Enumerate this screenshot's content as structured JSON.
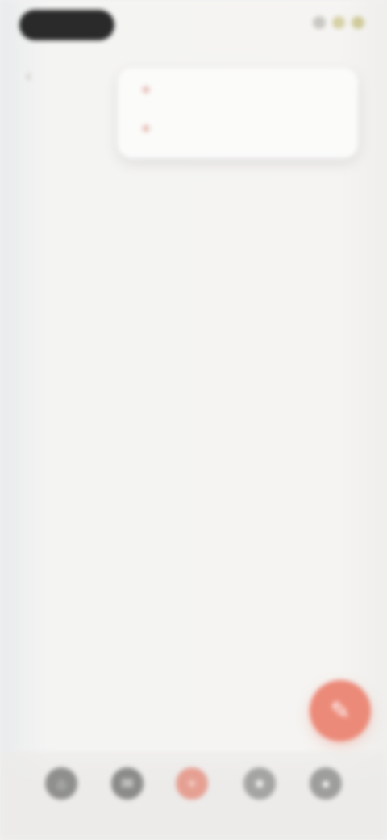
{
  "status_bar": {
    "time": "",
    "icons": [
      "signal-icon",
      "wifi-icon",
      "battery-icon"
    ]
  },
  "header": {
    "back_icon": "back-arrow-icon"
  },
  "popup_menu": {
    "items": [
      {
        "label": "",
        "icon": "dot-icon"
      },
      {
        "label": "",
        "icon": "dot-icon"
      }
    ]
  },
  "article": {
    "heading": "",
    "paragraphs": [
      "",
      "",
      "",
      "",
      "",
      ""
    ]
  },
  "fab": {
    "icon": "edit-icon"
  },
  "bottom_nav": {
    "items": [
      {
        "icon": "home-icon"
      },
      {
        "icon": "chat-icon"
      },
      {
        "icon": "add-icon"
      },
      {
        "icon": "bookmark-icon"
      },
      {
        "icon": "profile-icon"
      }
    ]
  },
  "colors": {
    "accent": "#ec8a79",
    "background": "#f4f4f3",
    "text": "#5d5d5b"
  }
}
